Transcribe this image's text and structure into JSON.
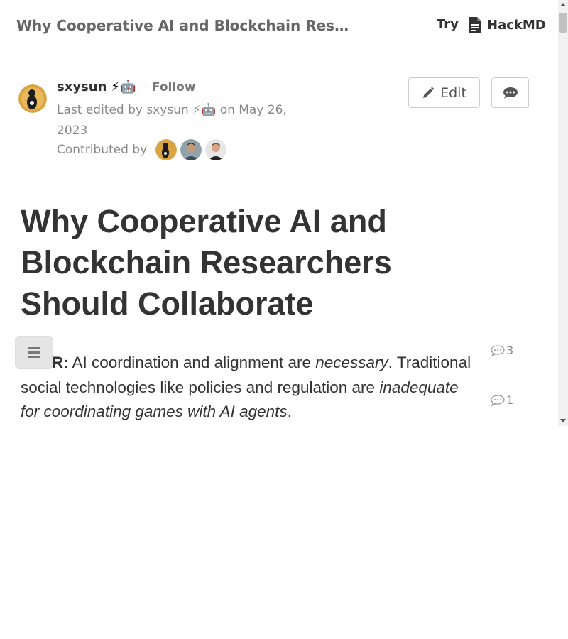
{
  "header": {
    "doc_title": "Why Cooperative AI and Blockchain Resea...",
    "try_label": "Try",
    "brand_label": "HackMD"
  },
  "author": {
    "name": "sxysun",
    "emoji": "⚡🤖",
    "follow_label": "Follow",
    "edited_prefix": "Last edited by",
    "edited_name": "sxysun",
    "edited_emoji": "⚡🤖",
    "edited_on": "on May 26, 2023",
    "contributed_label": "Contributed by"
  },
  "actions": {
    "edit_label": "Edit"
  },
  "article": {
    "title": "Why Cooperative AI and Blockchain Researchers Should Collaborate",
    "tldr_label": "TLDR:",
    "p1_a": " AI coordination and alignment are ",
    "p1_em1": "necessary",
    "p1_b": ". Traditional social technologies like policies and regulation are ",
    "p1_em2": "inadequate for coordinating games with AI agents",
    "p1_c": "."
  },
  "comments": {
    "count_1": "3",
    "count_2": "1"
  },
  "colors": {
    "text": "#333333",
    "muted": "#888888",
    "button_border": "#cccccc"
  }
}
